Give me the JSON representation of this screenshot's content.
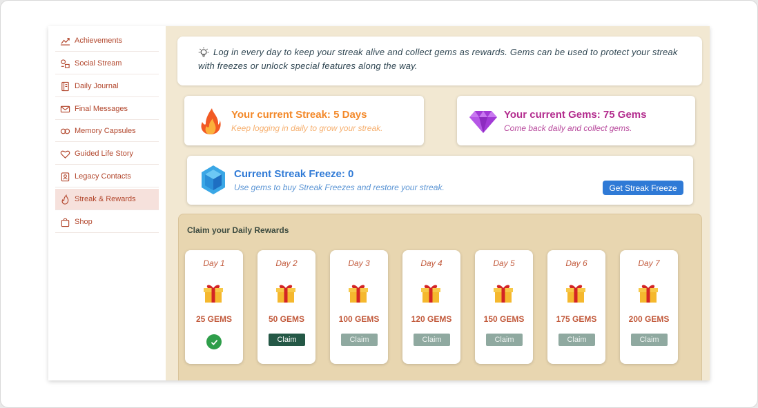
{
  "sidebar": {
    "items": [
      {
        "label": "Achievements",
        "icon": "chart-up-icon",
        "active": false
      },
      {
        "label": "Social Stream",
        "icon": "social-icon",
        "active": false
      },
      {
        "label": "Daily Journal",
        "icon": "journal-icon",
        "active": false
      },
      {
        "label": "Final Messages",
        "icon": "mail-icon",
        "active": false
      },
      {
        "label": "Memory Capsules",
        "icon": "capsule-icon",
        "active": false
      },
      {
        "label": "Guided Life Story",
        "icon": "heart-icon",
        "active": false
      },
      {
        "label": "Legacy Contacts",
        "icon": "contact-icon",
        "active": false
      },
      {
        "label": "Streak & Rewards",
        "icon": "flame-icon",
        "active": true
      },
      {
        "label": "Shop",
        "icon": "shopping-bag-icon",
        "active": false
      }
    ]
  },
  "info": {
    "text": "Log in every day to keep your streak alive and collect gems as rewards. Gems can be used to protect your streak with freezes or unlock special features along the way."
  },
  "streak": {
    "title": "Your current Streak: 5 Days",
    "subtitle": "Keep logging in daily to grow your streak."
  },
  "gems": {
    "title": "Your current Gems: 75 Gems",
    "subtitle": "Come back daily and collect gems."
  },
  "freeze": {
    "title": "Current Streak Freeze: 0",
    "subtitle": "Use gems to buy Streak Freezes and restore your streak.",
    "button_label": "Get Streak Freeze"
  },
  "rewards": {
    "title": "Claim your Daily Rewards",
    "days": [
      {
        "label": "Day 1",
        "gems": "25 GEMS",
        "state": "claimed"
      },
      {
        "label": "Day 2",
        "gems": "50 GEMS",
        "state": "available",
        "button": "Claim"
      },
      {
        "label": "Day 3",
        "gems": "100 GEMS",
        "state": "locked",
        "button": "Claim"
      },
      {
        "label": "Day 4",
        "gems": "120 GEMS",
        "state": "locked",
        "button": "Claim"
      },
      {
        "label": "Day 5",
        "gems": "150 GEMS",
        "state": "locked",
        "button": "Claim"
      },
      {
        "label": "Day 6",
        "gems": "175 GEMS",
        "state": "locked",
        "button": "Claim"
      },
      {
        "label": "Day 7",
        "gems": "200 GEMS",
        "state": "locked",
        "button": "Claim"
      }
    ]
  },
  "colors": {
    "accent_orange": "#f3892a",
    "accent_purple": "#b32c8e",
    "accent_blue": "#2f7ad6",
    "claim_green": "#245846",
    "sidebar_text": "#b2462c",
    "panel_bg": "#f2e8d2"
  }
}
